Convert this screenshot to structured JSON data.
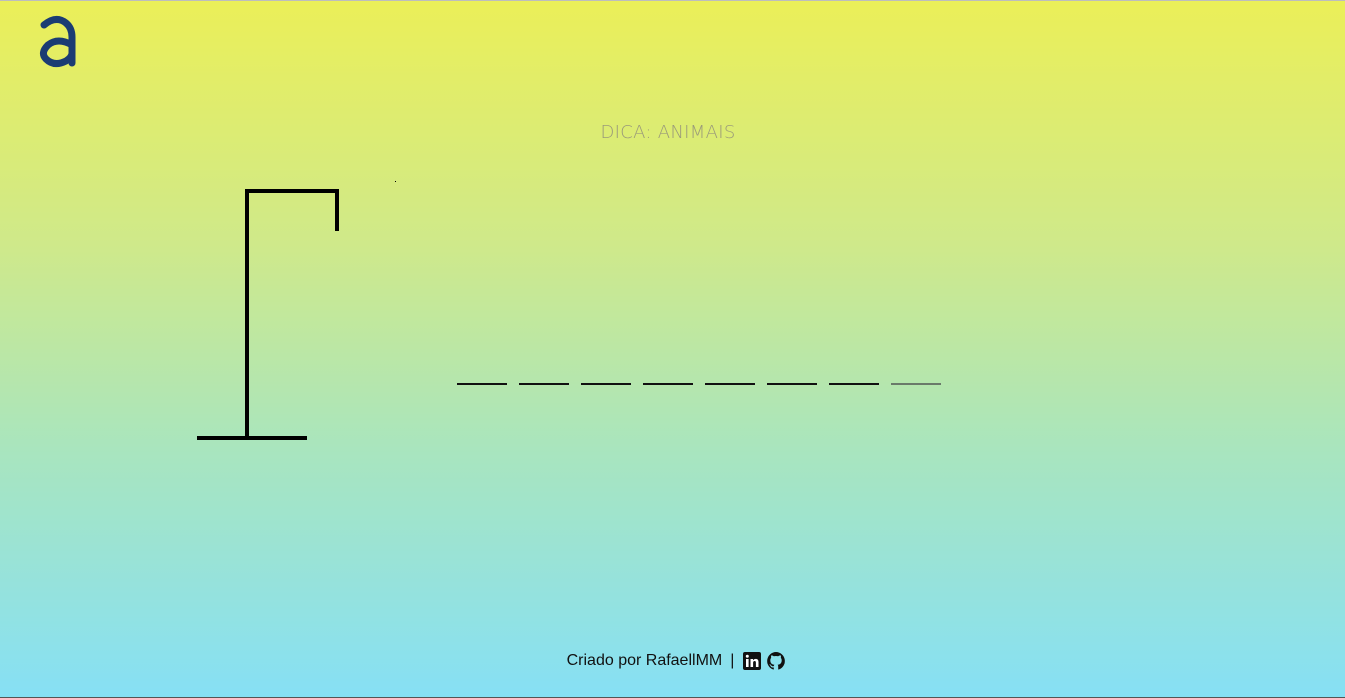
{
  "logo": {
    "glyph": "a",
    "color": "#1b3c73"
  },
  "hint": {
    "label": "DICA:",
    "value": "ANIMAIS"
  },
  "gallows": {
    "color": "#000000"
  },
  "word": {
    "letters": [
      "",
      "",
      "",
      "",
      "",
      "",
      "",
      ""
    ],
    "slot_count": 8
  },
  "footer": {
    "credit": "Criado por RafaellMM",
    "separator": "|",
    "icons": [
      "linkedin-icon",
      "github-icon"
    ]
  }
}
